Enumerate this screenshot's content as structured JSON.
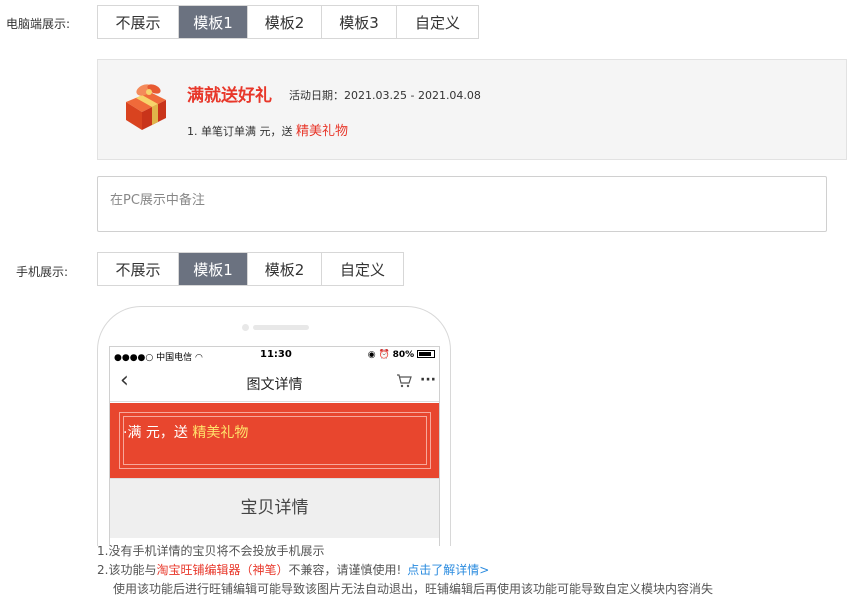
{
  "pc": {
    "label": "电脑端展示:",
    "tabs": [
      {
        "label": "不展示",
        "active": false
      },
      {
        "label": "模板1",
        "active": true
      },
      {
        "label": "模板2",
        "active": false
      },
      {
        "label": "模板3",
        "active": false
      },
      {
        "label": "自定义",
        "active": false
      }
    ],
    "preview": {
      "title": "满就送好礼",
      "date": "活动日期：2021.03.25 - 2021.04.08",
      "line_prefix": "1. 单笔订单满 元，送",
      "line_highlight": "精美礼物"
    },
    "note_placeholder": "在PC展示中备注"
  },
  "mobile": {
    "label": "手机展示:",
    "tabs": [
      {
        "label": "不展示",
        "active": false
      },
      {
        "label": "模板1",
        "active": true
      },
      {
        "label": "模板2",
        "active": false
      },
      {
        "label": "自定义",
        "active": false
      }
    ],
    "phone": {
      "carrier": "●●●●○ 中国电信 ",
      "time": "11:30",
      "battery": "80%",
      "nav_title": "图文详情",
      "banner_prefix": "·满 元，送",
      "banner_highlight": "精美礼物",
      "section_title": "宝贝详情"
    }
  },
  "tips": {
    "line1": "1.没有手机详情的宝贝将不会投放手机展示",
    "line2_prefix": "2.该功能与",
    "line2_red": "淘宝旺铺编辑器（神笔）",
    "line2_suffix": "不兼容，请谨慎使用!",
    "line2_link": "点击了解详情>",
    "line3": "使用该功能后进行旺铺编辑可能导致该图片无法自动退出，旺铺编辑后再使用该功能可能导致自定义模块内容消失"
  },
  "colors": {
    "accent_red": "#e8372a",
    "active_tab": "#6b7280",
    "link": "#2a8bdf",
    "banner": "#e8462e"
  }
}
